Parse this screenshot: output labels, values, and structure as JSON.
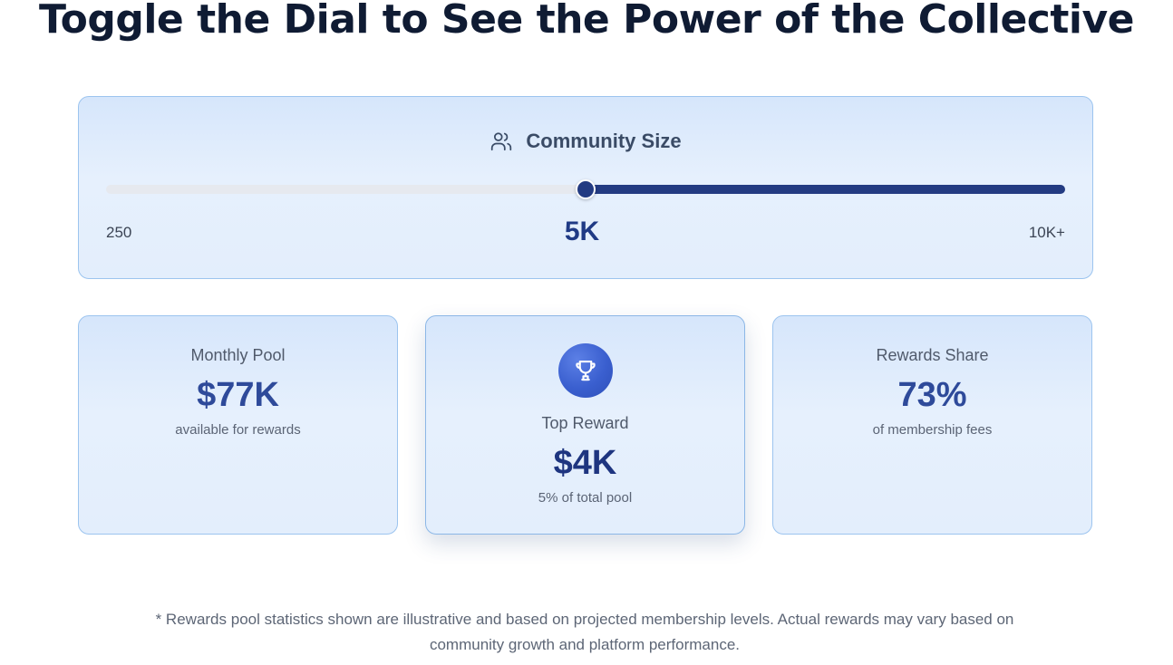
{
  "heading": "Toggle the Dial to See the Power of the Collective",
  "slider": {
    "title": "Community Size",
    "icon": "users-icon",
    "min_label": "250",
    "max_label": "10K+",
    "value_label": "5K",
    "value_fraction": 0.5,
    "track_color": "#e6e9ef",
    "fill_color": "#233b82"
  },
  "cards": {
    "monthly_pool": {
      "label": "Monthly Pool",
      "value": "$77K",
      "sub": "available for rewards"
    },
    "top_reward": {
      "icon": "trophy-icon",
      "label": "Top Reward",
      "value": "$4K",
      "sub": "5% of total pool"
    },
    "rewards_share": {
      "label": "Rewards Share",
      "value": "73%",
      "sub": "of membership fees"
    }
  },
  "footnote": "* Rewards pool statistics shown are illustrative and based on projected membership levels. Actual rewards may vary based on community growth and platform performance.",
  "colors": {
    "accent": "#233b82",
    "value_text": "#2e4a9a",
    "panel_border": "#9cc4ef",
    "badge": "#3a5fcf"
  }
}
